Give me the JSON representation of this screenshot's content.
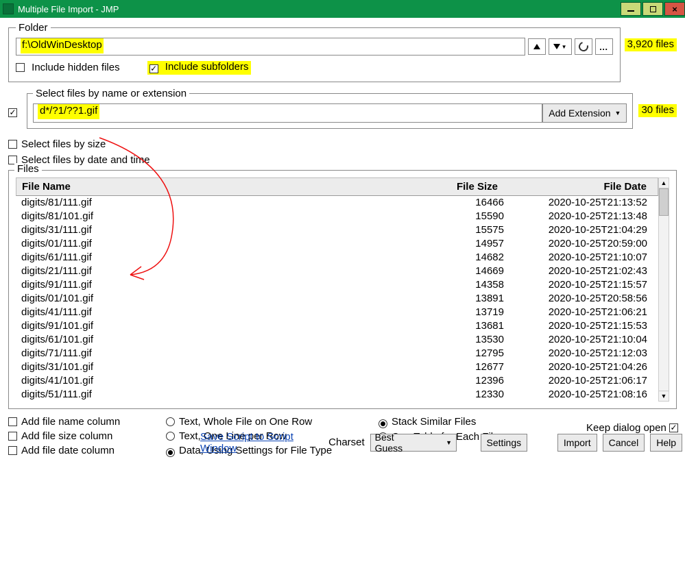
{
  "window": {
    "title": "Multiple File Import - JMP"
  },
  "folder": {
    "legend": "Folder",
    "path": "f:\\OldWinDesktop",
    "include_hidden_label": "Include hidden files",
    "include_hidden_checked": false,
    "include_subfolders_label": "Include subfolders",
    "include_subfolders_checked": true,
    "total_files": "3,920 files"
  },
  "filter": {
    "legend": "Select files by name or extension",
    "pattern": "d*/?1/??1.gif",
    "add_ext_label": "Add Extension",
    "match_count": "30 files",
    "section_checked": true
  },
  "by_size": {
    "label": "Select files by size",
    "checked": false
  },
  "by_date": {
    "label": "Select files by date and time",
    "checked": false
  },
  "files": {
    "legend": "Files",
    "columns": {
      "name": "File Name",
      "size": "File Size",
      "date": "File Date"
    },
    "rows": [
      {
        "name": "digits/81/111.gif",
        "size": "16466",
        "date": "2020-10-25T21:13:52"
      },
      {
        "name": "digits/81/101.gif",
        "size": "15590",
        "date": "2020-10-25T21:13:48"
      },
      {
        "name": "digits/31/111.gif",
        "size": "15575",
        "date": "2020-10-25T21:04:29"
      },
      {
        "name": "digits/01/111.gif",
        "size": "14957",
        "date": "2020-10-25T20:59:00"
      },
      {
        "name": "digits/61/111.gif",
        "size": "14682",
        "date": "2020-10-25T21:10:07"
      },
      {
        "name": "digits/21/111.gif",
        "size": "14669",
        "date": "2020-10-25T21:02:43"
      },
      {
        "name": "digits/91/111.gif",
        "size": "14358",
        "date": "2020-10-25T21:15:57"
      },
      {
        "name": "digits/01/101.gif",
        "size": "13891",
        "date": "2020-10-25T20:58:56"
      },
      {
        "name": "digits/41/111.gif",
        "size": "13719",
        "date": "2020-10-25T21:06:21"
      },
      {
        "name": "digits/91/101.gif",
        "size": "13681",
        "date": "2020-10-25T21:15:53"
      },
      {
        "name": "digits/61/101.gif",
        "size": "13530",
        "date": "2020-10-25T21:10:04"
      },
      {
        "name": "digits/71/111.gif",
        "size": "12795",
        "date": "2020-10-25T21:12:03"
      },
      {
        "name": "digits/31/101.gif",
        "size": "12677",
        "date": "2020-10-25T21:04:26"
      },
      {
        "name": "digits/41/101.gif",
        "size": "12396",
        "date": "2020-10-25T21:06:17"
      },
      {
        "name": "digits/51/111.gif",
        "size": "12330",
        "date": "2020-10-25T21:08:16"
      }
    ]
  },
  "opts": {
    "add_name": "Add file name column",
    "add_size": "Add file size column",
    "add_date": "Add file date column",
    "text_one_row": "Text, Whole File on One Row",
    "text_line_row": "Text, One Line per Row",
    "data_settings": "Data, Using Settings for File Type",
    "stack": "Stack Similar Files",
    "one_table": "One Table for Each File"
  },
  "bottom": {
    "save_script": "Save Script to Script Window",
    "charset_label": "Charset",
    "charset_value": "Best Guess",
    "settings": "Settings",
    "import": "Import",
    "cancel": "Cancel",
    "help": "Help",
    "keep_open": "Keep dialog open"
  }
}
